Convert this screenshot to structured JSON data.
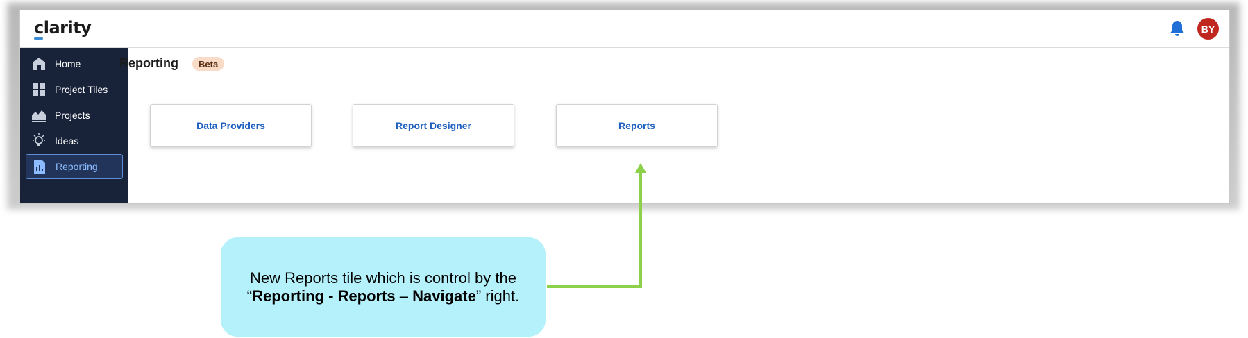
{
  "app": {
    "logo": "clarity",
    "avatar_initials": "BY",
    "avatar_color": "#c0281f"
  },
  "sidebar": {
    "items": [
      {
        "label": "Home",
        "icon": "home-icon"
      },
      {
        "label": "Project Tiles",
        "icon": "tiles-icon"
      },
      {
        "label": "Projects",
        "icon": "projects-icon"
      },
      {
        "label": "Ideas",
        "icon": "lightbulb-icon"
      },
      {
        "label": "Reporting",
        "icon": "reporting-icon",
        "active": true
      }
    ]
  },
  "main": {
    "title": "Reporting",
    "badge": "Beta",
    "tiles": [
      {
        "label": "Data Providers"
      },
      {
        "label": "Report Designer"
      },
      {
        "label": "Reports"
      }
    ]
  },
  "annotation": {
    "line1": "New Reports tile which is control by the",
    "line2_open": "“",
    "line2_bold": "Reporting - Reports",
    "line2_dash": " – ",
    "line2_bold2": "Navigate",
    "line2_close": "” right.",
    "arrow_color": "#8dd04a",
    "callout_color": "#b5f1fa"
  },
  "colors": {
    "sidebar_bg": "#18233a",
    "active_text": "#8cbcff",
    "tile_text": "#1f5fbf",
    "bell": "#1f6fd6"
  }
}
